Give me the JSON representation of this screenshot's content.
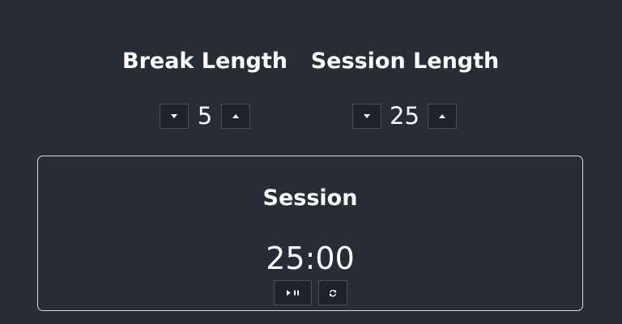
{
  "break": {
    "label": "Break Length",
    "value": "5",
    "decrement_icon": "caret-down-icon",
    "increment_icon": "caret-up-icon"
  },
  "session": {
    "label": "Session Length",
    "value": "25",
    "decrement_icon": "caret-down-icon",
    "increment_icon": "caret-up-icon"
  },
  "timer": {
    "label": "Session",
    "time_left": "25:00",
    "start_stop_icon": "play-pause-icon",
    "reset_icon": "refresh-icon"
  },
  "colors": {
    "background": "#282c34",
    "text": "#ffffff",
    "border": "#d7d9dc",
    "button_bg": "#1f2227"
  }
}
